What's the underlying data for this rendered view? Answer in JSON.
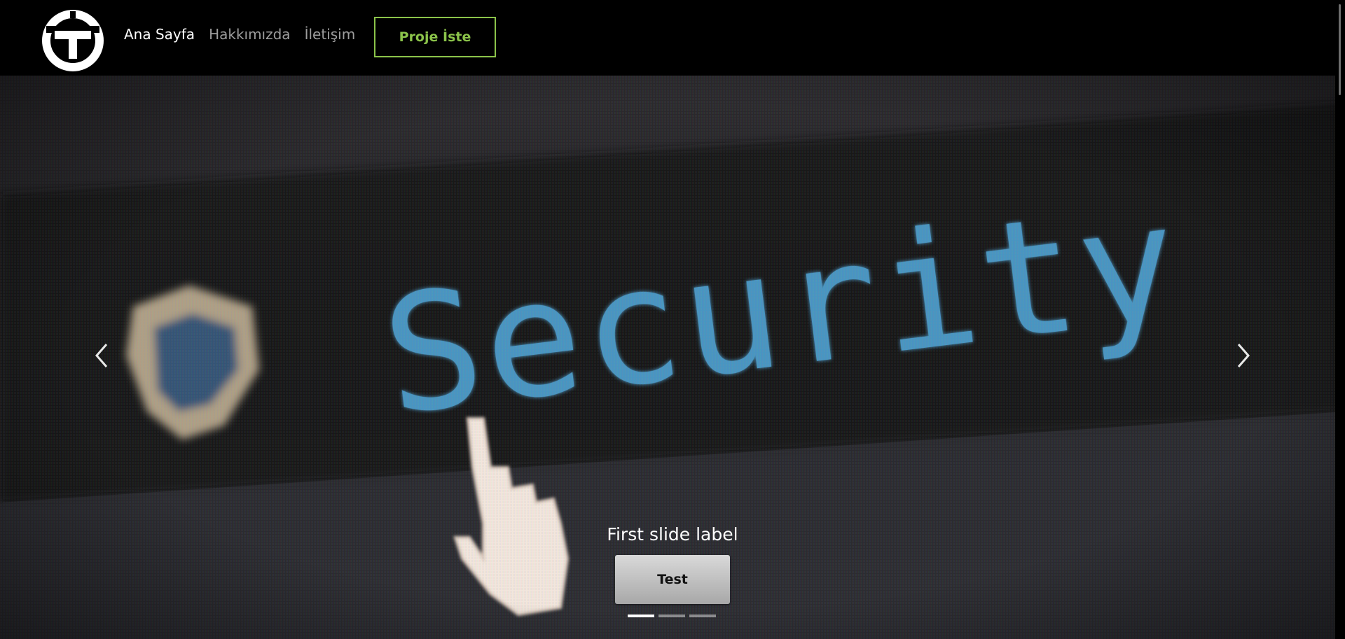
{
  "navbar": {
    "logo_icon": "letter-t-circle-logo",
    "links": [
      {
        "label": "Ana Sayfa",
        "active": true
      },
      {
        "label": "Hakkımızda",
        "active": false
      },
      {
        "label": "İletişim",
        "active": false
      }
    ],
    "cta_label": "Proje İste"
  },
  "hero": {
    "image_description_icon": "security-screen-photo",
    "image_text": "Security",
    "slide_caption": "First slide label",
    "slide_button_label": "Test",
    "slide_count": 3,
    "active_slide": 1,
    "prev_icon": "chevron-left-icon",
    "next_icon": "chevron-right-icon"
  },
  "colors": {
    "background": "#000000",
    "accent": "#8bc34a",
    "security_text": "#5aa9d6"
  }
}
